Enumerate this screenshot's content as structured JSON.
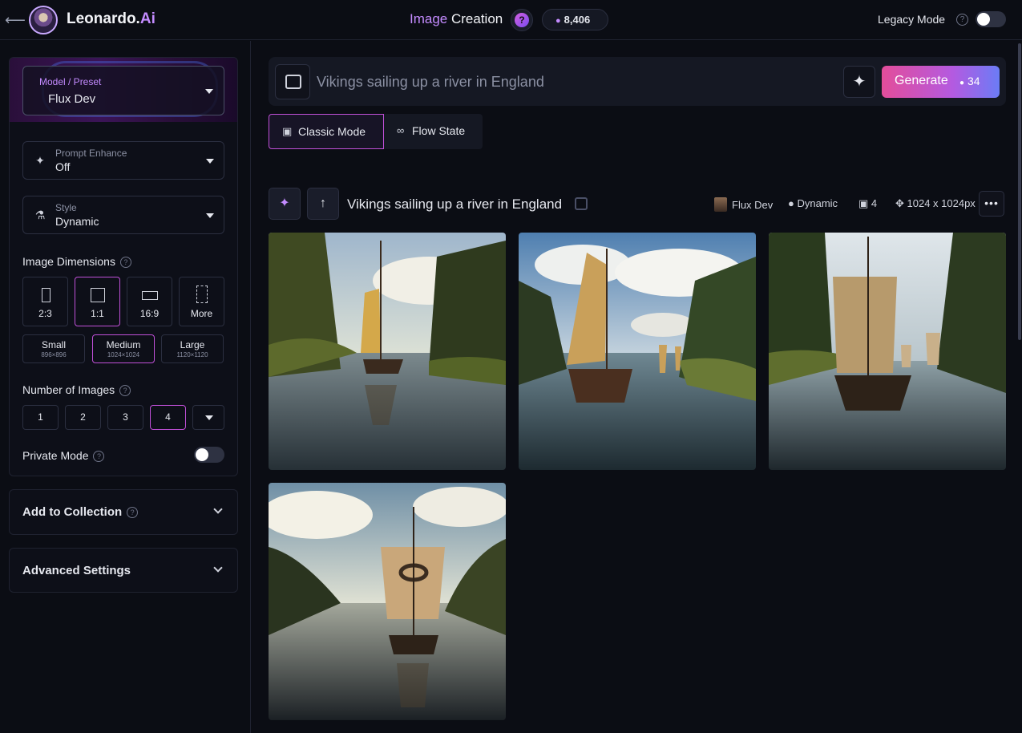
{
  "header": {
    "back_label": "⟵",
    "logo_text": "Leonardo.",
    "logo_suffix": "Ai",
    "title_part1": "Image",
    "title_part2": " Creation",
    "help_label": "?",
    "token_balance": "8,406",
    "legacy_mode_label": "Legacy Mode",
    "legacy_help": "?",
    "legacy_mode_on": false
  },
  "sidebar": {
    "model": {
      "label": "Model / Preset",
      "value": "Flux Dev"
    },
    "prompt_enhance": {
      "label": "Prompt Enhance",
      "value": "Off"
    },
    "style": {
      "label": "Style",
      "value": "Dynamic"
    },
    "dimensions": {
      "title": "Image Dimensions",
      "ratios": [
        "2:3",
        "1:1",
        "16:9",
        "More"
      ],
      "selected_ratio": "1:1",
      "sizes": [
        {
          "label": "Small",
          "px": "896×896"
        },
        {
          "label": "Medium",
          "px": "1024×1024"
        },
        {
          "label": "Large",
          "px": "1120×1120"
        }
      ],
      "selected_size": "Medium"
    },
    "number_of_images": {
      "title": "Number of Images",
      "options": [
        "1",
        "2",
        "3",
        "4"
      ],
      "selected": "4"
    },
    "private_mode": {
      "label": "Private Mode",
      "on": false
    },
    "add_to_collection": "Add to Collection",
    "advanced_settings": "Advanced Settings"
  },
  "main": {
    "prompt": {
      "placeholder": "Vikings sailing up a river in England",
      "value": ""
    },
    "generate": {
      "label": "Generate",
      "cost": "34"
    },
    "modes": [
      "Classic Mode",
      "Flow State"
    ],
    "active_mode": "Classic Mode",
    "generation": {
      "prompt": "Vikings sailing up a river in England",
      "model": "Flux Dev",
      "style": "Dynamic",
      "count": "4",
      "dimensions": "1024 x 1024px",
      "more": "•••"
    },
    "images": [
      {
        "alt": "Viking ship with yellow sail on a tree-lined river"
      },
      {
        "alt": "Viking longship with tan sail followed by other ships"
      },
      {
        "alt": "Viking longship with square sail rowing up river"
      },
      {
        "alt": "Viking ship with emblem sail on a calm river at dusk"
      }
    ]
  },
  "colors": {
    "accent": "#c48bff",
    "selected_border": "#c050d8",
    "generate_gradient_start": "#e34d9a",
    "generate_gradient_end": "#6b7cf6",
    "background": "#0b0d14"
  }
}
